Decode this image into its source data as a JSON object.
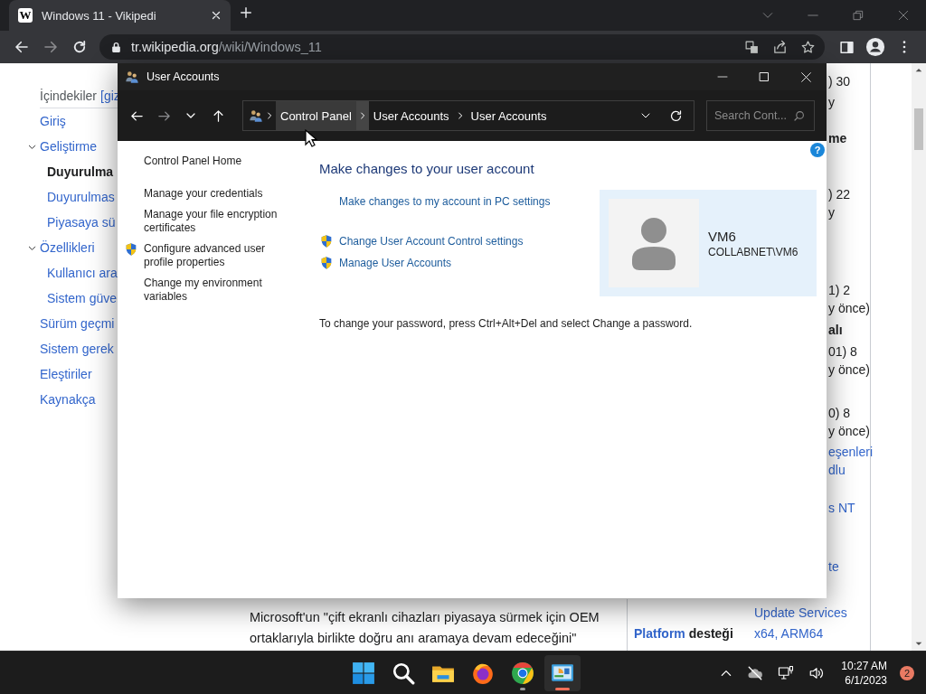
{
  "browser": {
    "tab": {
      "favicon": "W",
      "title": "Windows 11 - Vikipedi"
    },
    "url": {
      "host": "tr.wikipedia.org",
      "path": "/wiki/Windows_11"
    }
  },
  "wiki": {
    "toc": {
      "title": "İçindekiler",
      "toggle": "[giz",
      "items": [
        {
          "label": "Giriş",
          "selected": false
        },
        {
          "label": "Geliştirme",
          "selected": false,
          "expanded": true,
          "children": [
            {
              "label": "Duyurulma",
              "selected": true
            },
            {
              "label": "Duyurulmas",
              "selected": false
            },
            {
              "label": "Piyasaya sü",
              "selected": false
            }
          ]
        },
        {
          "label": "Özellikleri",
          "selected": false,
          "expanded": true,
          "children": [
            {
              "label": "Kullanıcı ara",
              "selected": false
            },
            {
              "label": "Sistem güve",
              "selected": false
            }
          ]
        },
        {
          "label": "Sürüm geçmi",
          "selected": false
        },
        {
          "label": "Sistem gerek",
          "selected": false
        },
        {
          "label": "Eleştiriler",
          "selected": false
        },
        {
          "label": "Kaynakça",
          "selected": false
        }
      ]
    },
    "article_lines": [
      "Microsoft'un \"çift ekranlı cihazları piyasaya sürmek için OEM",
      "ortaklarıyla birlikte doğru anı aramaya devam edeceğini\""
    ],
    "infobox_fragments": [
      {
        "text": ") 30",
        "kind": "value"
      },
      {
        "text": "y",
        "kind": "value"
      },
      {
        "text": "me",
        "kind": "label"
      },
      {
        "text": ") 22",
        "kind": "value"
      },
      {
        "text": "y",
        "kind": "value"
      },
      {
        "text": "1) 2",
        "kind": "value"
      },
      {
        "text": "y önce)",
        "kind": "value"
      },
      {
        "text": "alı",
        "kind": "label"
      },
      {
        "text": "01) 8",
        "kind": "value"
      },
      {
        "text": "y önce)",
        "kind": "value"
      },
      {
        "text": "0) 8",
        "kind": "value"
      },
      {
        "text": "y önce)",
        "kind": "value"
      },
      {
        "text": "eşenleri",
        "kind": "link"
      },
      {
        "text": "dlu",
        "kind": "link"
      },
      {
        "text": "s NT",
        "kind": "link"
      },
      {
        "text": "te",
        "kind": "link"
      }
    ],
    "infobox_rows": [
      {
        "value": "Update Services"
      },
      {
        "label_link": "Platform",
        "label": "desteği",
        "value": "x64, ARM64"
      }
    ]
  },
  "window": {
    "title": "User Accounts",
    "breadcrumb": [
      {
        "label": "Control Panel",
        "hovered": true
      },
      {
        "label": "User Accounts",
        "hovered": false
      },
      {
        "label": "User Accounts",
        "hovered": false
      }
    ],
    "search": {
      "placeholder": "Search Cont..."
    },
    "help": "?",
    "tasks": [
      {
        "label": "Control Panel Home",
        "shield": false
      },
      {
        "label": "Manage your credentials",
        "shield": false
      },
      {
        "label": "Manage your file encryption certificates",
        "shield": false
      },
      {
        "label": "Configure advanced user profile properties",
        "shield": true
      },
      {
        "label": "Change my environment variables",
        "shield": false
      }
    ],
    "heading": "Make changes to your user account",
    "links": [
      {
        "label": "Make changes to my account in PC settings",
        "shield": false
      },
      {
        "label": "Change User Account Control settings",
        "shield": true
      },
      {
        "label": "Manage User Accounts",
        "shield": true
      }
    ],
    "account": {
      "name": "VM6",
      "domain": "COLLABNET\\VM6"
    },
    "note": "To change your password, press Ctrl+Alt+Del and select Change a password."
  },
  "taskbar": {
    "apps": [
      {
        "kind": "start",
        "running": false,
        "selected": false
      },
      {
        "kind": "search",
        "running": false,
        "selected": false
      },
      {
        "kind": "explorer",
        "running": false,
        "selected": false
      },
      {
        "kind": "firefox",
        "running": false,
        "selected": false
      },
      {
        "kind": "chrome",
        "running": true,
        "selected": false
      },
      {
        "kind": "control-panel",
        "running": true,
        "selected": true
      }
    ],
    "time": "10:27 AM",
    "date": "6/1/2023",
    "notifications": "2"
  }
}
